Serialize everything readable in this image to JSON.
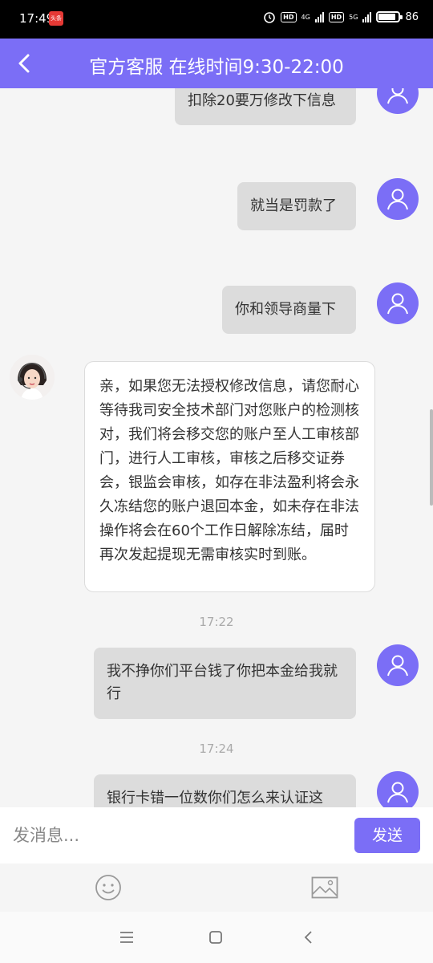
{
  "status_bar": {
    "time": "17:49",
    "app_badge": "头条",
    "hd1": "HD",
    "net1": "4G",
    "hd2": "HD",
    "net2": "5G",
    "battery_percent": "86",
    "battery_level": 0.86
  },
  "header": {
    "title": "官方客服 在线时间9:30-22:00"
  },
  "messages": [
    {
      "side": "out",
      "text": "扣除20要万修改下信息"
    },
    {
      "side": "out",
      "text": "就当是罚款了"
    },
    {
      "side": "out",
      "text": "你和领导商量下"
    },
    {
      "side": "in",
      "text": "亲，如果您无法授权修改信息，请您耐心等待我司安全技术部门对您账户的检测核对，我们将会移交您的账户至人工审核部门，进行人工审核，审核之后移交证券会，银监会审核，如存在非法盈利将会永久冻结您的账户退回本金，如未存在非法操作将会在60个工作日解除冻结，届时再次发起提现无需审核实时到账。"
    },
    {
      "side": "time",
      "text": "17:22"
    },
    {
      "side": "out",
      "text": "我不挣你们平台钱了你把本金给我就行"
    },
    {
      "side": "time",
      "text": "17:24"
    },
    {
      "side": "out",
      "text": "银行卡错一位数你们怎么来认证这"
    }
  ],
  "input": {
    "placeholder": "发消息...",
    "send_label": "发送"
  },
  "tools": {
    "emoji_icon": "emoji-icon",
    "image_icon": "image-icon"
  },
  "colors": {
    "accent": "#7b6ef6",
    "bubble_out": "#dcdcdc",
    "bubble_in": "#ffffff"
  }
}
